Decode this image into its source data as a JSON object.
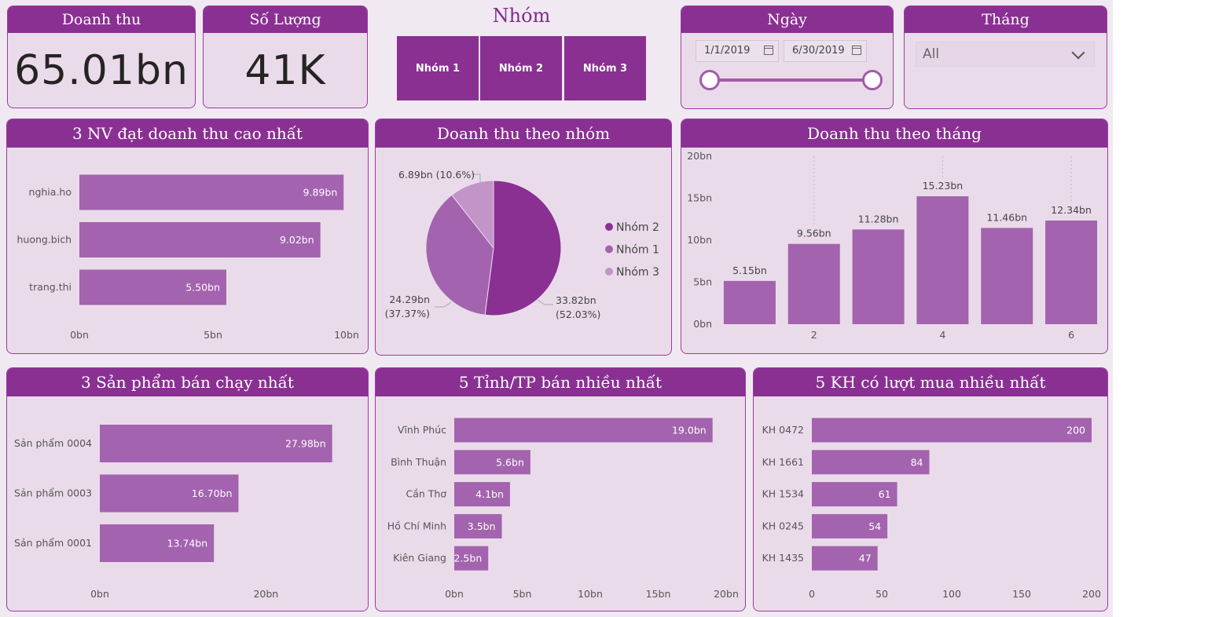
{
  "kpis": {
    "revenue": {
      "title": "Doanh thu",
      "value": "65.01bn"
    },
    "quantity": {
      "title": "Số Lượng",
      "value": "41K"
    }
  },
  "group_slicer": {
    "title": "Nhóm",
    "options": [
      "Nhóm 1",
      "Nhóm 2",
      "Nhóm 3"
    ]
  },
  "date_slicer": {
    "title": "Ngày",
    "start": "1/1/2019",
    "end": "6/30/2019"
  },
  "month_slicer": {
    "title": "Tháng",
    "value": "All"
  },
  "colors": {
    "primary": "#8a3093",
    "bar": "#a363ae",
    "pie": [
      "#8a3093",
      "#a363ae",
      "#c294c8"
    ],
    "card_bg": "#eadbea"
  },
  "icons": {
    "calendar": "calendar-icon",
    "dropdown": "chevron-down-icon"
  },
  "chart_data": [
    {
      "id": "top_staff",
      "type": "bar",
      "title": "3 NV đạt doanh thu cao nhất",
      "categories": [
        "nghia.ho",
        "huong.bich",
        "trang.thi"
      ],
      "values": [
        9.89,
        9.02,
        5.5
      ],
      "labels": [
        "9.89bn",
        "9.02bn",
        "5.50bn"
      ],
      "xlim": [
        0,
        10
      ],
      "ticks": [
        "0bn",
        "5bn",
        "10bn"
      ]
    },
    {
      "id": "revenue_by_group",
      "type": "pie",
      "title": "Doanh thu theo nhóm",
      "series": [
        {
          "name": "Nhóm 2",
          "value": 33.82,
          "label1": "33.82bn",
          "label2": "(52.03%)"
        },
        {
          "name": "Nhóm 1",
          "value": 24.29,
          "label1": "24.29bn",
          "label2": "(37.37%)"
        },
        {
          "name": "Nhóm 3",
          "value": 6.89,
          "label1": "6.89bn (10.6%)",
          "label2": ""
        }
      ],
      "legend": "right"
    },
    {
      "id": "revenue_by_month",
      "type": "bar",
      "title": "Doanh thu theo tháng",
      "categories": [
        "1",
        "2",
        "3",
        "4",
        "5",
        "6"
      ],
      "values": [
        5.15,
        9.56,
        11.28,
        15.23,
        11.46,
        12.34
      ],
      "labels": [
        "5.15bn",
        "9.56bn",
        "11.28bn",
        "15.23bn",
        "11.46bn",
        "12.34bn"
      ],
      "ylim": [
        0,
        20
      ],
      "yticks": [
        "0bn",
        "5bn",
        "10bn",
        "15bn",
        "20bn"
      ],
      "xticks_shown": [
        "2",
        "4",
        "6"
      ]
    },
    {
      "id": "top_products",
      "type": "bar",
      "title": "3 Sản phẩm bán chạy nhất",
      "categories": [
        "Sản phẩm 0004",
        "Sản phẩm 0003",
        "Sản phẩm 0001"
      ],
      "values": [
        27.98,
        16.7,
        13.74
      ],
      "labels": [
        "27.98bn",
        "16.70bn",
        "13.74bn"
      ],
      "xlim": [
        0,
        30
      ],
      "ticks": [
        "0bn",
        "20bn"
      ],
      "tick_values": [
        0,
        20
      ]
    },
    {
      "id": "top_provinces",
      "type": "bar",
      "title": "5 Tỉnh/TP bán nhiều nhất",
      "categories": [
        "Vĩnh Phúc",
        "Bình Thuận",
        "Cần Thơ",
        "Hồ Chí Minh",
        "Kiên Giang"
      ],
      "values": [
        19.0,
        5.6,
        4.1,
        3.5,
        2.5
      ],
      "labels": [
        "19.0bn",
        "5.6bn",
        "4.1bn",
        "3.5bn",
        "2.5bn"
      ],
      "xlim": [
        0,
        20
      ],
      "ticks": [
        "0bn",
        "5bn",
        "10bn",
        "15bn",
        "20bn"
      ]
    },
    {
      "id": "top_customers",
      "type": "bar",
      "title": "5 KH có lượt mua nhiều nhất",
      "categories": [
        "KH 0472",
        "KH 1661",
        "KH 1534",
        "KH 0245",
        "KH 1435"
      ],
      "values": [
        200,
        84,
        61,
        54,
        47
      ],
      "labels": [
        "200",
        "84",
        "61",
        "54",
        "47"
      ],
      "xlim": [
        0,
        200
      ],
      "ticks": [
        "0",
        "50",
        "100",
        "150",
        "200"
      ]
    }
  ]
}
